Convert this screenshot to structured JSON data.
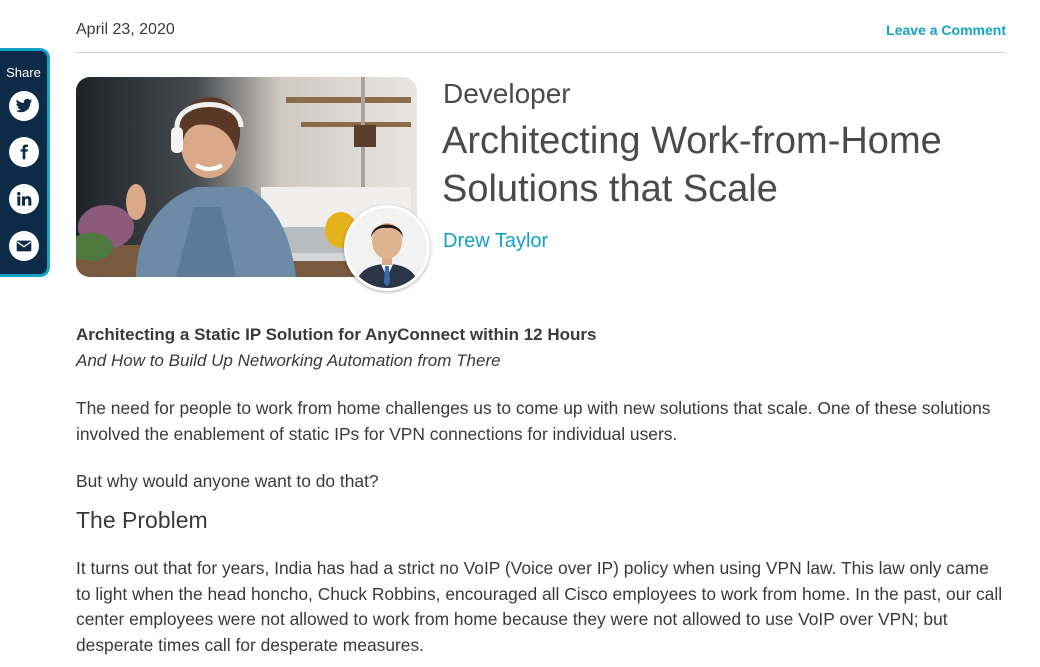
{
  "post": {
    "date": "April 23, 2020",
    "comment_link": "Leave a Comment",
    "category": "Developer",
    "title": "Architecting Work-from-Home Solutions that Scale",
    "author": "Drew Taylor"
  },
  "share": {
    "label": "Share",
    "icons": [
      "twitter-icon",
      "facebook-icon",
      "linkedin-icon",
      "email-icon"
    ]
  },
  "colors": {
    "accent": "#14a3c7",
    "share_bg": "#0d2a47",
    "text": "#3a3a3a"
  },
  "article": {
    "subtitle_bold": "Architecting a Static IP Solution for AnyConnect within 12 Hours",
    "subtitle_italic": "And How to Build Up Networking Automation from There",
    "para1": "The need for people to work from home challenges us to come up with new solutions that scale. One of these solutions involved the enablement of static IPs for VPN connections for individual users.",
    "para2": "But why would anyone want to do that?",
    "heading": "The Problem",
    "para3": "It turns out that for years, India has had a strict no VoIP (Voice over IP) policy when using VPN law. This law only came to light when the head honcho, Chuck Robbins, encouraged all Cisco employees to work from home. In the past, our call center employees were not allowed to work from home because they were not allowed to use VoIP over VPN; but desperate times call for desperate measures."
  }
}
